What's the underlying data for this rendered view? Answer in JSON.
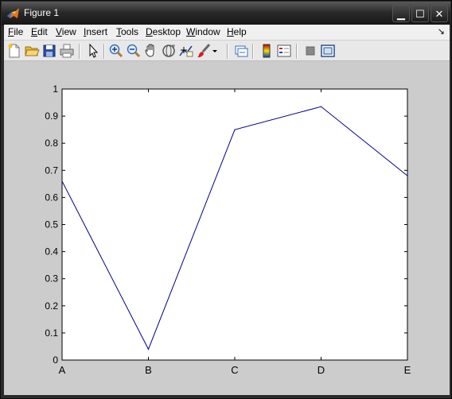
{
  "window": {
    "title": "Figure 1"
  },
  "titlebar_buttons": {
    "minimize": "▁",
    "maximize": "☐",
    "close": "✕"
  },
  "menu": [
    {
      "label": "File",
      "mnemonic": "F"
    },
    {
      "label": "Edit",
      "mnemonic": "E"
    },
    {
      "label": "View",
      "mnemonic": "V"
    },
    {
      "label": "Insert",
      "mnemonic": "I"
    },
    {
      "label": "Tools",
      "mnemonic": "T"
    },
    {
      "label": "Desktop",
      "mnemonic": "D"
    },
    {
      "label": "Window",
      "mnemonic": "W"
    },
    {
      "label": "Help",
      "mnemonic": "H"
    }
  ],
  "toolbar": {
    "icons": [
      "new-figure-icon",
      "open-file-icon",
      "save-icon",
      "print-icon",
      "edit-plot-arrow-icon",
      "zoom-in-icon",
      "zoom-out-icon",
      "pan-hand-icon",
      "rotate-3d-icon",
      "data-cursor-icon",
      "brush-icon",
      "brush-dropdown-icon",
      "link-plot-icon",
      "insert-colorbar-icon",
      "insert-legend-icon",
      "hide-plot-tools-icon",
      "show-plot-tools-icon"
    ]
  },
  "chart_data": {
    "type": "line",
    "categories": [
      "A",
      "B",
      "C",
      "D",
      "E"
    ],
    "series": [
      {
        "values": [
          0.66,
          0.04,
          0.85,
          0.935,
          0.68
        ],
        "color": "#00008b"
      }
    ],
    "ylim": [
      0,
      1
    ],
    "yticks": [
      0,
      0.1,
      0.2,
      0.3,
      0.4,
      0.5,
      0.6,
      0.7,
      0.8,
      0.9,
      1
    ],
    "ytick_labels": [
      "0",
      "0.1",
      "0.2",
      "0.3",
      "0.4",
      "0.5",
      "0.6",
      "0.7",
      "0.8",
      "0.9",
      "1"
    ],
    "grid": false,
    "title": "",
    "xlabel": "",
    "ylabel": ""
  }
}
